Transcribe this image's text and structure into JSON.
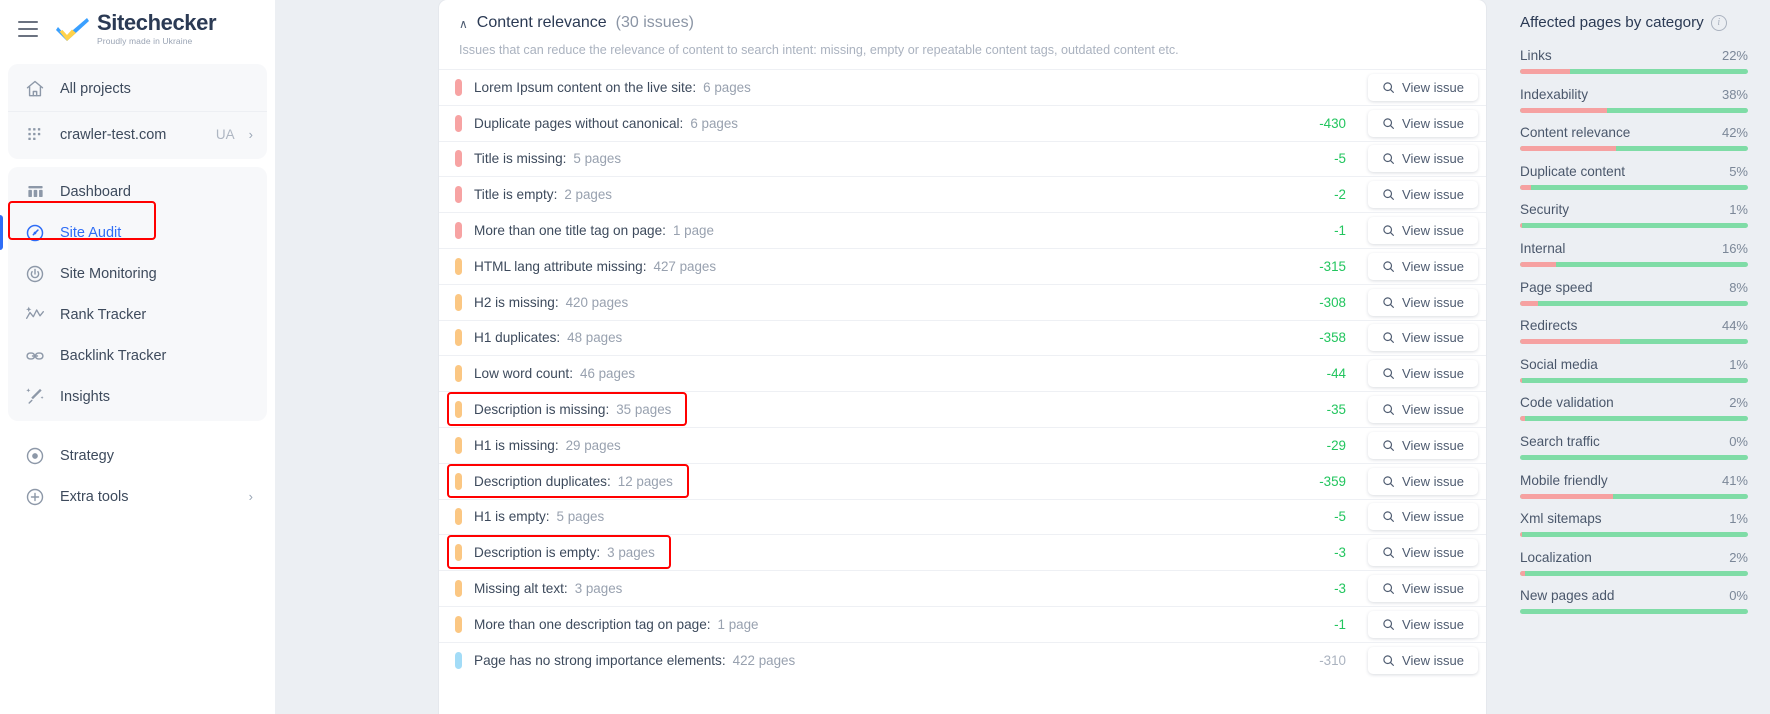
{
  "brand": {
    "name": "Sitechecker",
    "tagline": "Proudly made in Ukraine"
  },
  "sidebar": {
    "projects": [
      {
        "icon": "home-icon",
        "label": "All projects"
      },
      {
        "icon": "grid-dots-icon",
        "label": "crawler-test.com",
        "tag": "UA",
        "chevron": "›"
      }
    ],
    "tools": [
      {
        "icon": "dashboard-icon",
        "label": "Dashboard",
        "active": false
      },
      {
        "icon": "site-audit-icon",
        "label": "Site Audit",
        "active": true
      },
      {
        "icon": "site-monitoring-icon",
        "label": "Site Monitoring",
        "active": false
      },
      {
        "icon": "rank-tracker-icon",
        "label": "Rank Tracker",
        "active": false
      },
      {
        "icon": "backlink-tracker-icon",
        "label": "Backlink Tracker",
        "active": false
      },
      {
        "icon": "insights-icon",
        "label": "Insights",
        "active": false
      }
    ],
    "extras": [
      {
        "icon": "strategy-icon",
        "label": "Strategy"
      },
      {
        "icon": "extra-tools-icon",
        "label": "Extra tools",
        "chevron": "›"
      }
    ]
  },
  "section": {
    "caret": "∧",
    "title": "Content relevance",
    "count": "(30 issues)",
    "description": "Issues that can reduce the relevance of content to search intent: missing, empty or repeatable content tags, outdated content etc.",
    "view_issue_label": "View issue"
  },
  "issues": [
    {
      "severity": "red",
      "name": "Lorem Ipsum content on the live site:",
      "pages": "6 pages",
      "delta": "",
      "highlight": false
    },
    {
      "severity": "red",
      "name": "Duplicate pages without canonical:",
      "pages": "6 pages",
      "delta": "-430",
      "highlight": false
    },
    {
      "severity": "red",
      "name": "Title is missing:",
      "pages": "5 pages",
      "delta": "-5",
      "highlight": false
    },
    {
      "severity": "red",
      "name": "Title is empty:",
      "pages": "2 pages",
      "delta": "-2",
      "highlight": false
    },
    {
      "severity": "red",
      "name": "More than one title tag on page:",
      "pages": "1 page",
      "delta": "-1",
      "highlight": false
    },
    {
      "severity": "orange",
      "name": "HTML lang attribute missing:",
      "pages": "427 pages",
      "delta": "-315",
      "highlight": false
    },
    {
      "severity": "orange",
      "name": "H2 is missing:",
      "pages": "420 pages",
      "delta": "-308",
      "highlight": false
    },
    {
      "severity": "orange",
      "name": "H1 duplicates:",
      "pages": "48 pages",
      "delta": "-358",
      "highlight": false
    },
    {
      "severity": "orange",
      "name": "Low word count:",
      "pages": "46 pages",
      "delta": "-44",
      "highlight": false
    },
    {
      "severity": "orange",
      "name": "Description is missing:",
      "pages": "35 pages",
      "delta": "-35",
      "highlight": true
    },
    {
      "severity": "orange",
      "name": "H1 is missing:",
      "pages": "29 pages",
      "delta": "-29",
      "highlight": false
    },
    {
      "severity": "orange",
      "name": "Description duplicates:",
      "pages": "12 pages",
      "delta": "-359",
      "highlight": true
    },
    {
      "severity": "orange",
      "name": "H1 is empty:",
      "pages": "5 pages",
      "delta": "-5",
      "highlight": false
    },
    {
      "severity": "orange",
      "name": "Description is empty:",
      "pages": "3 pages",
      "delta": "-3",
      "highlight": true
    },
    {
      "severity": "orange",
      "name": "Missing alt text:",
      "pages": "3 pages",
      "delta": "-3",
      "highlight": false
    },
    {
      "severity": "orange",
      "name": "More than one description tag on page:",
      "pages": "1 page",
      "delta": "-1",
      "highlight": false
    },
    {
      "severity": "blue",
      "name": "Page has no strong importance elements:",
      "pages": "422 pages",
      "delta": "-310",
      "highlight": false,
      "delta_muted": true
    }
  ],
  "right_panel": {
    "title": "Affected pages by category",
    "info_glyph": "i",
    "categories": [
      {
        "label": "Links",
        "pct": "22%",
        "value": 22
      },
      {
        "label": "Indexability",
        "pct": "38%",
        "value": 38
      },
      {
        "label": "Content relevance",
        "pct": "42%",
        "value": 42
      },
      {
        "label": "Duplicate content",
        "pct": "5%",
        "value": 5
      },
      {
        "label": "Security",
        "pct": "1%",
        "value": 1
      },
      {
        "label": "Internal",
        "pct": "16%",
        "value": 16
      },
      {
        "label": "Page speed",
        "pct": "8%",
        "value": 8
      },
      {
        "label": "Redirects",
        "pct": "44%",
        "value": 44
      },
      {
        "label": "Social media",
        "pct": "1%",
        "value": 1
      },
      {
        "label": "Code validation",
        "pct": "2%",
        "value": 2
      },
      {
        "label": "Search traffic",
        "pct": "0%",
        "value": 0
      },
      {
        "label": "Mobile friendly",
        "pct": "41%",
        "value": 41
      },
      {
        "label": "Xml sitemaps",
        "pct": "1%",
        "value": 1
      },
      {
        "label": "Localization",
        "pct": "2%",
        "value": 2
      },
      {
        "label": "New pages add",
        "pct": "0%",
        "value": 0
      }
    ]
  },
  "colors": {
    "accent": "#2f6df6",
    "severity_red": "#f7a3a3",
    "severity_orange": "#fbc783",
    "severity_blue": "#a3dcf7",
    "delta_green": "#22c55e",
    "bar_affected": "#f6a1a1",
    "bar_ok": "#7fdca6",
    "highlight": "#ff0000"
  }
}
